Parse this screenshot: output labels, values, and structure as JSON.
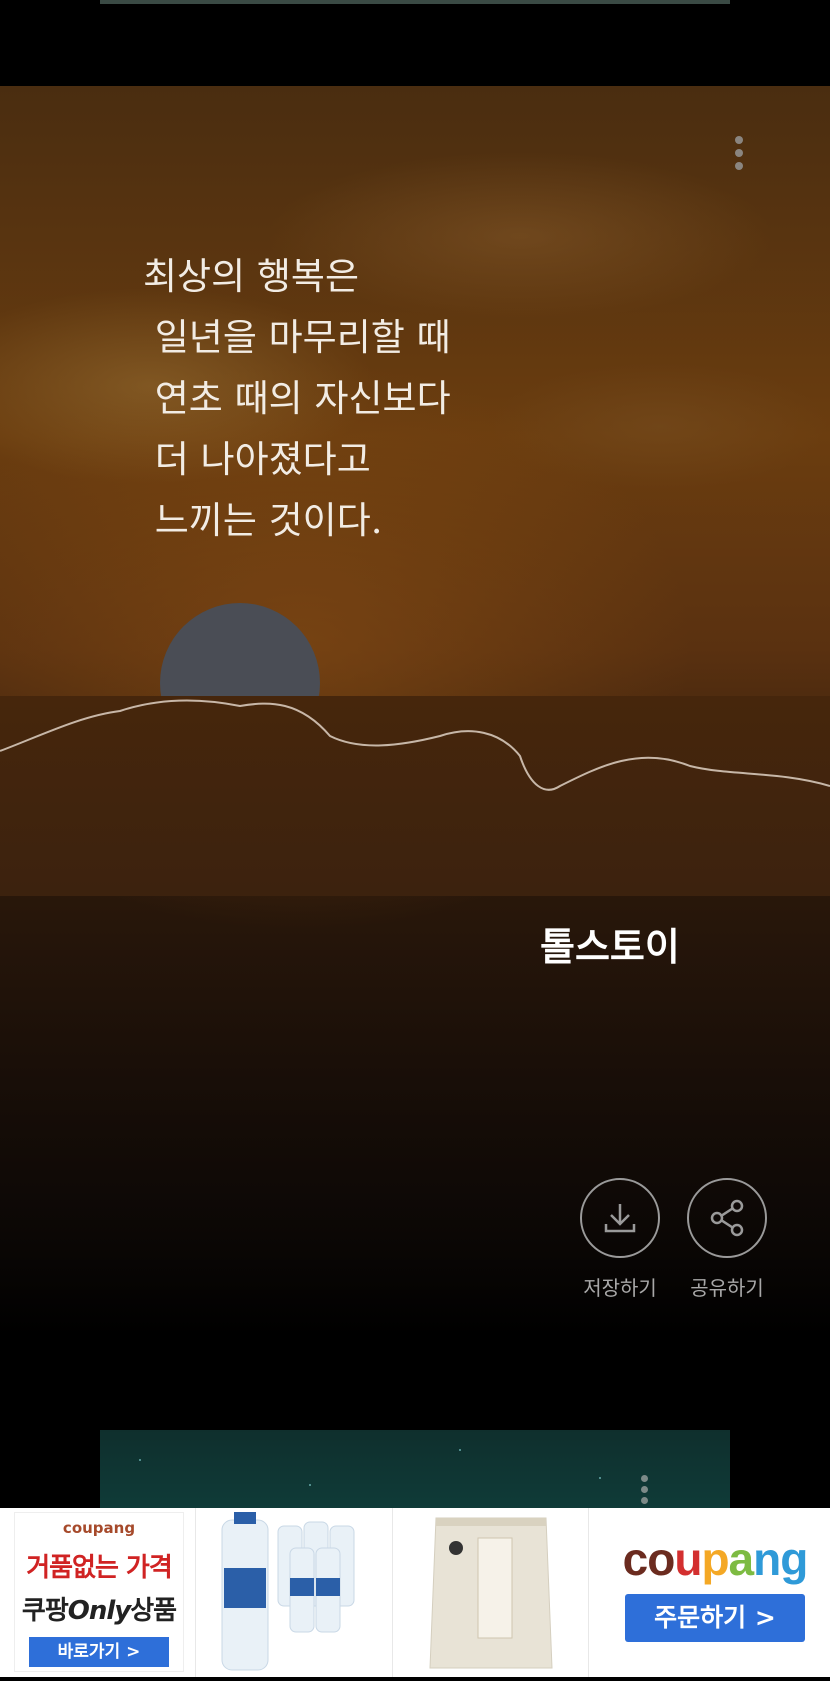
{
  "quote_card": {
    "quote_lines": [
      "최상의 행복은",
      " 일년을 마무리할 때",
      " 연초 때의 자신보다",
      " 더 나아졌다고",
      " 느끼는 것이다."
    ],
    "author": "톨스토이",
    "menu_icon": "more-vertical-icon",
    "actions": {
      "save": {
        "label": "저장하기",
        "icon": "download-icon"
      },
      "share": {
        "label": "공유하기",
        "icon": "share-icon"
      }
    }
  },
  "ad_banner": {
    "brand": "coupang",
    "tile1": {
      "line1": "거품없는 가격",
      "line2_prefix": "쿠팡",
      "line2_em": "Only",
      "line2_suffix": "상품",
      "button": "바로가기 >"
    },
    "tile2": {
      "product": "water-bottles-image"
    },
    "tile3": {
      "product": "rice-bag-image"
    },
    "tile4": {
      "logo": "coupang",
      "button": "주문하기 >"
    },
    "colors": {
      "blue": "#2e6fd9",
      "red": "#d02323"
    }
  }
}
